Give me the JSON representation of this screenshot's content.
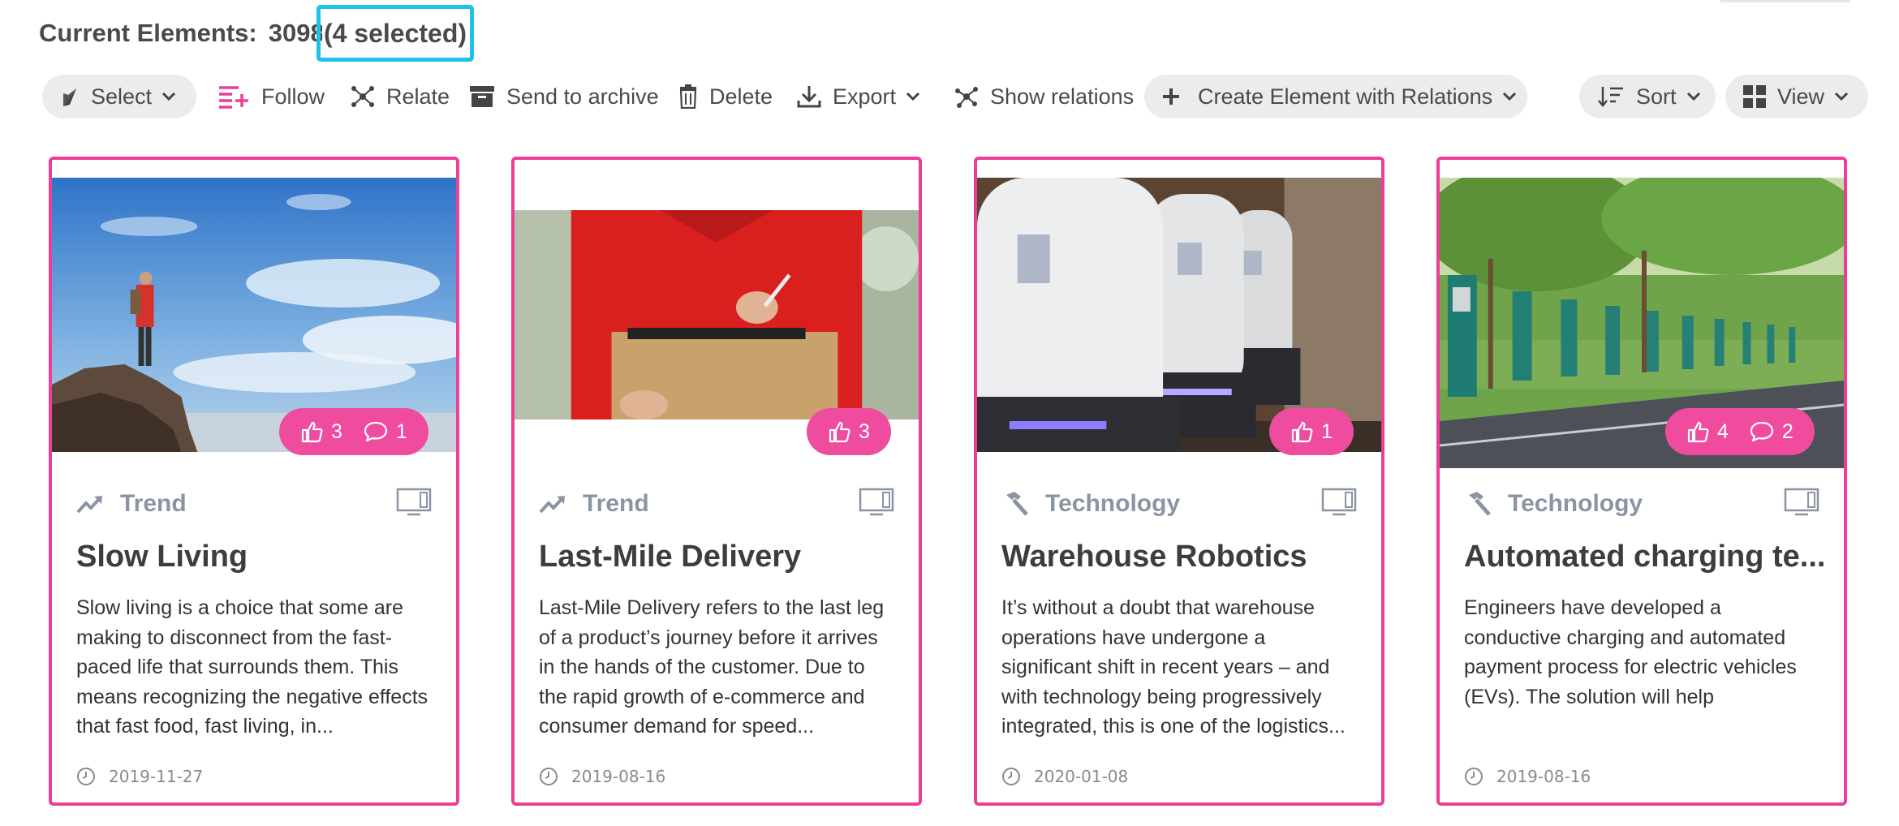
{
  "header": {
    "label": "Current Elements:",
    "count": "3098",
    "selected": "(4 selected)"
  },
  "toolbar": {
    "select": "Select",
    "follow": "Follow",
    "relate": "Relate",
    "archive": "Send to archive",
    "delete": "Delete",
    "export": "Export",
    "show_relations": "Show relations",
    "create": "Create Element with Relations",
    "sort": "Sort",
    "view": "View"
  },
  "colors": {
    "accent": "#ec3d97",
    "selection_highlight": "#1fc1e6",
    "category_text": "#8b94a3"
  },
  "cards": [
    {
      "category": "Trend",
      "category_icon": "trend-icon",
      "title": "Slow Living",
      "desc": "Slow living is a choice that some are making to disconnect from the fast-paced life that surrounds them. This means recognizing the negative effects that fast food, fast living, in...",
      "date": "2019-11-27",
      "likes": "3",
      "comments": "1"
    },
    {
      "category": "Trend",
      "category_icon": "trend-icon",
      "title": "Last-Mile Delivery",
      "desc": "Last-Mile Delivery refers to the last leg of a product’s journey before it arrives in the hands of the customer. Due to the rapid growth of e-commerce and consumer demand for speed...",
      "date": "2019-08-16",
      "likes": "3"
    },
    {
      "category": "Technology",
      "category_icon": "hammer-icon",
      "title": "Warehouse Robotics",
      "desc": "It’s without a doubt that warehouse operations have undergone a significant shift in recent years – and with technology being progressively integrated, this is one of the logistics...",
      "date": "2020-01-08",
      "likes": "1"
    },
    {
      "category": "Technology",
      "category_icon": "hammer-icon",
      "title": "Automated charging te...",
      "desc": "Engineers have developed a conductive charging and automated payment process for electric vehicles (EVs). The solution will help",
      "date": "2019-08-16",
      "likes": "4",
      "comments": "2"
    }
  ]
}
